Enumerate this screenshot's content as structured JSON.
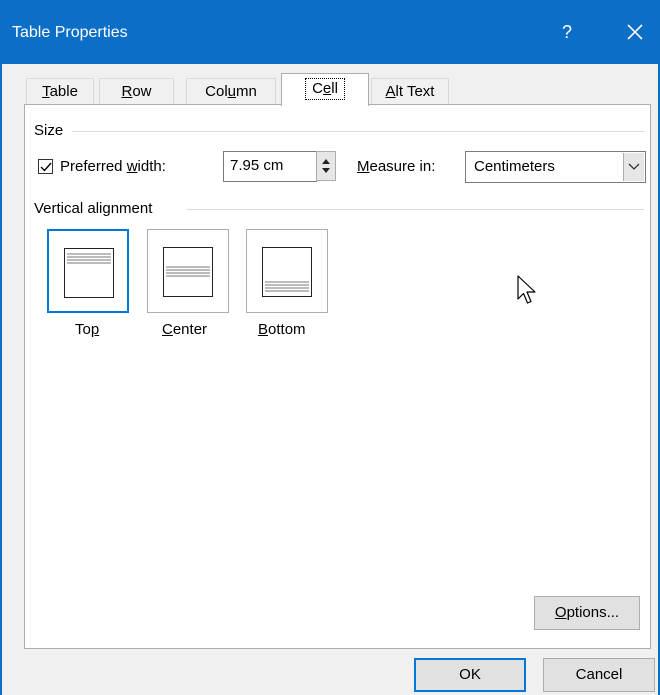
{
  "window": {
    "title": "Table Properties",
    "help_label": "?",
    "close_icon": "close-icon"
  },
  "tabs": [
    {
      "label": "Table",
      "active": false
    },
    {
      "label": "Row",
      "active": false
    },
    {
      "label": "Column",
      "active": false
    },
    {
      "label": "Cell",
      "active": true
    },
    {
      "label": "Alt Text",
      "active": false
    }
  ],
  "size_group": {
    "label": "Size",
    "preferred_width_checked": true,
    "preferred_width_label": "Preferred width:",
    "preferred_width_value": "7.95 cm",
    "measure_in_label": "Measure in:",
    "measure_in_value": "Centimeters"
  },
  "vertical_alignment": {
    "label": "Vertical alignment",
    "options": [
      {
        "label": "Top",
        "selected": true
      },
      {
        "label": "Center",
        "selected": false
      },
      {
        "label": "Bottom",
        "selected": false
      }
    ]
  },
  "buttons": {
    "options": "Options...",
    "ok": "OK",
    "cancel": "Cancel"
  },
  "colors": {
    "titlebar": "#0b6fc8",
    "selection": "#0078d7"
  }
}
